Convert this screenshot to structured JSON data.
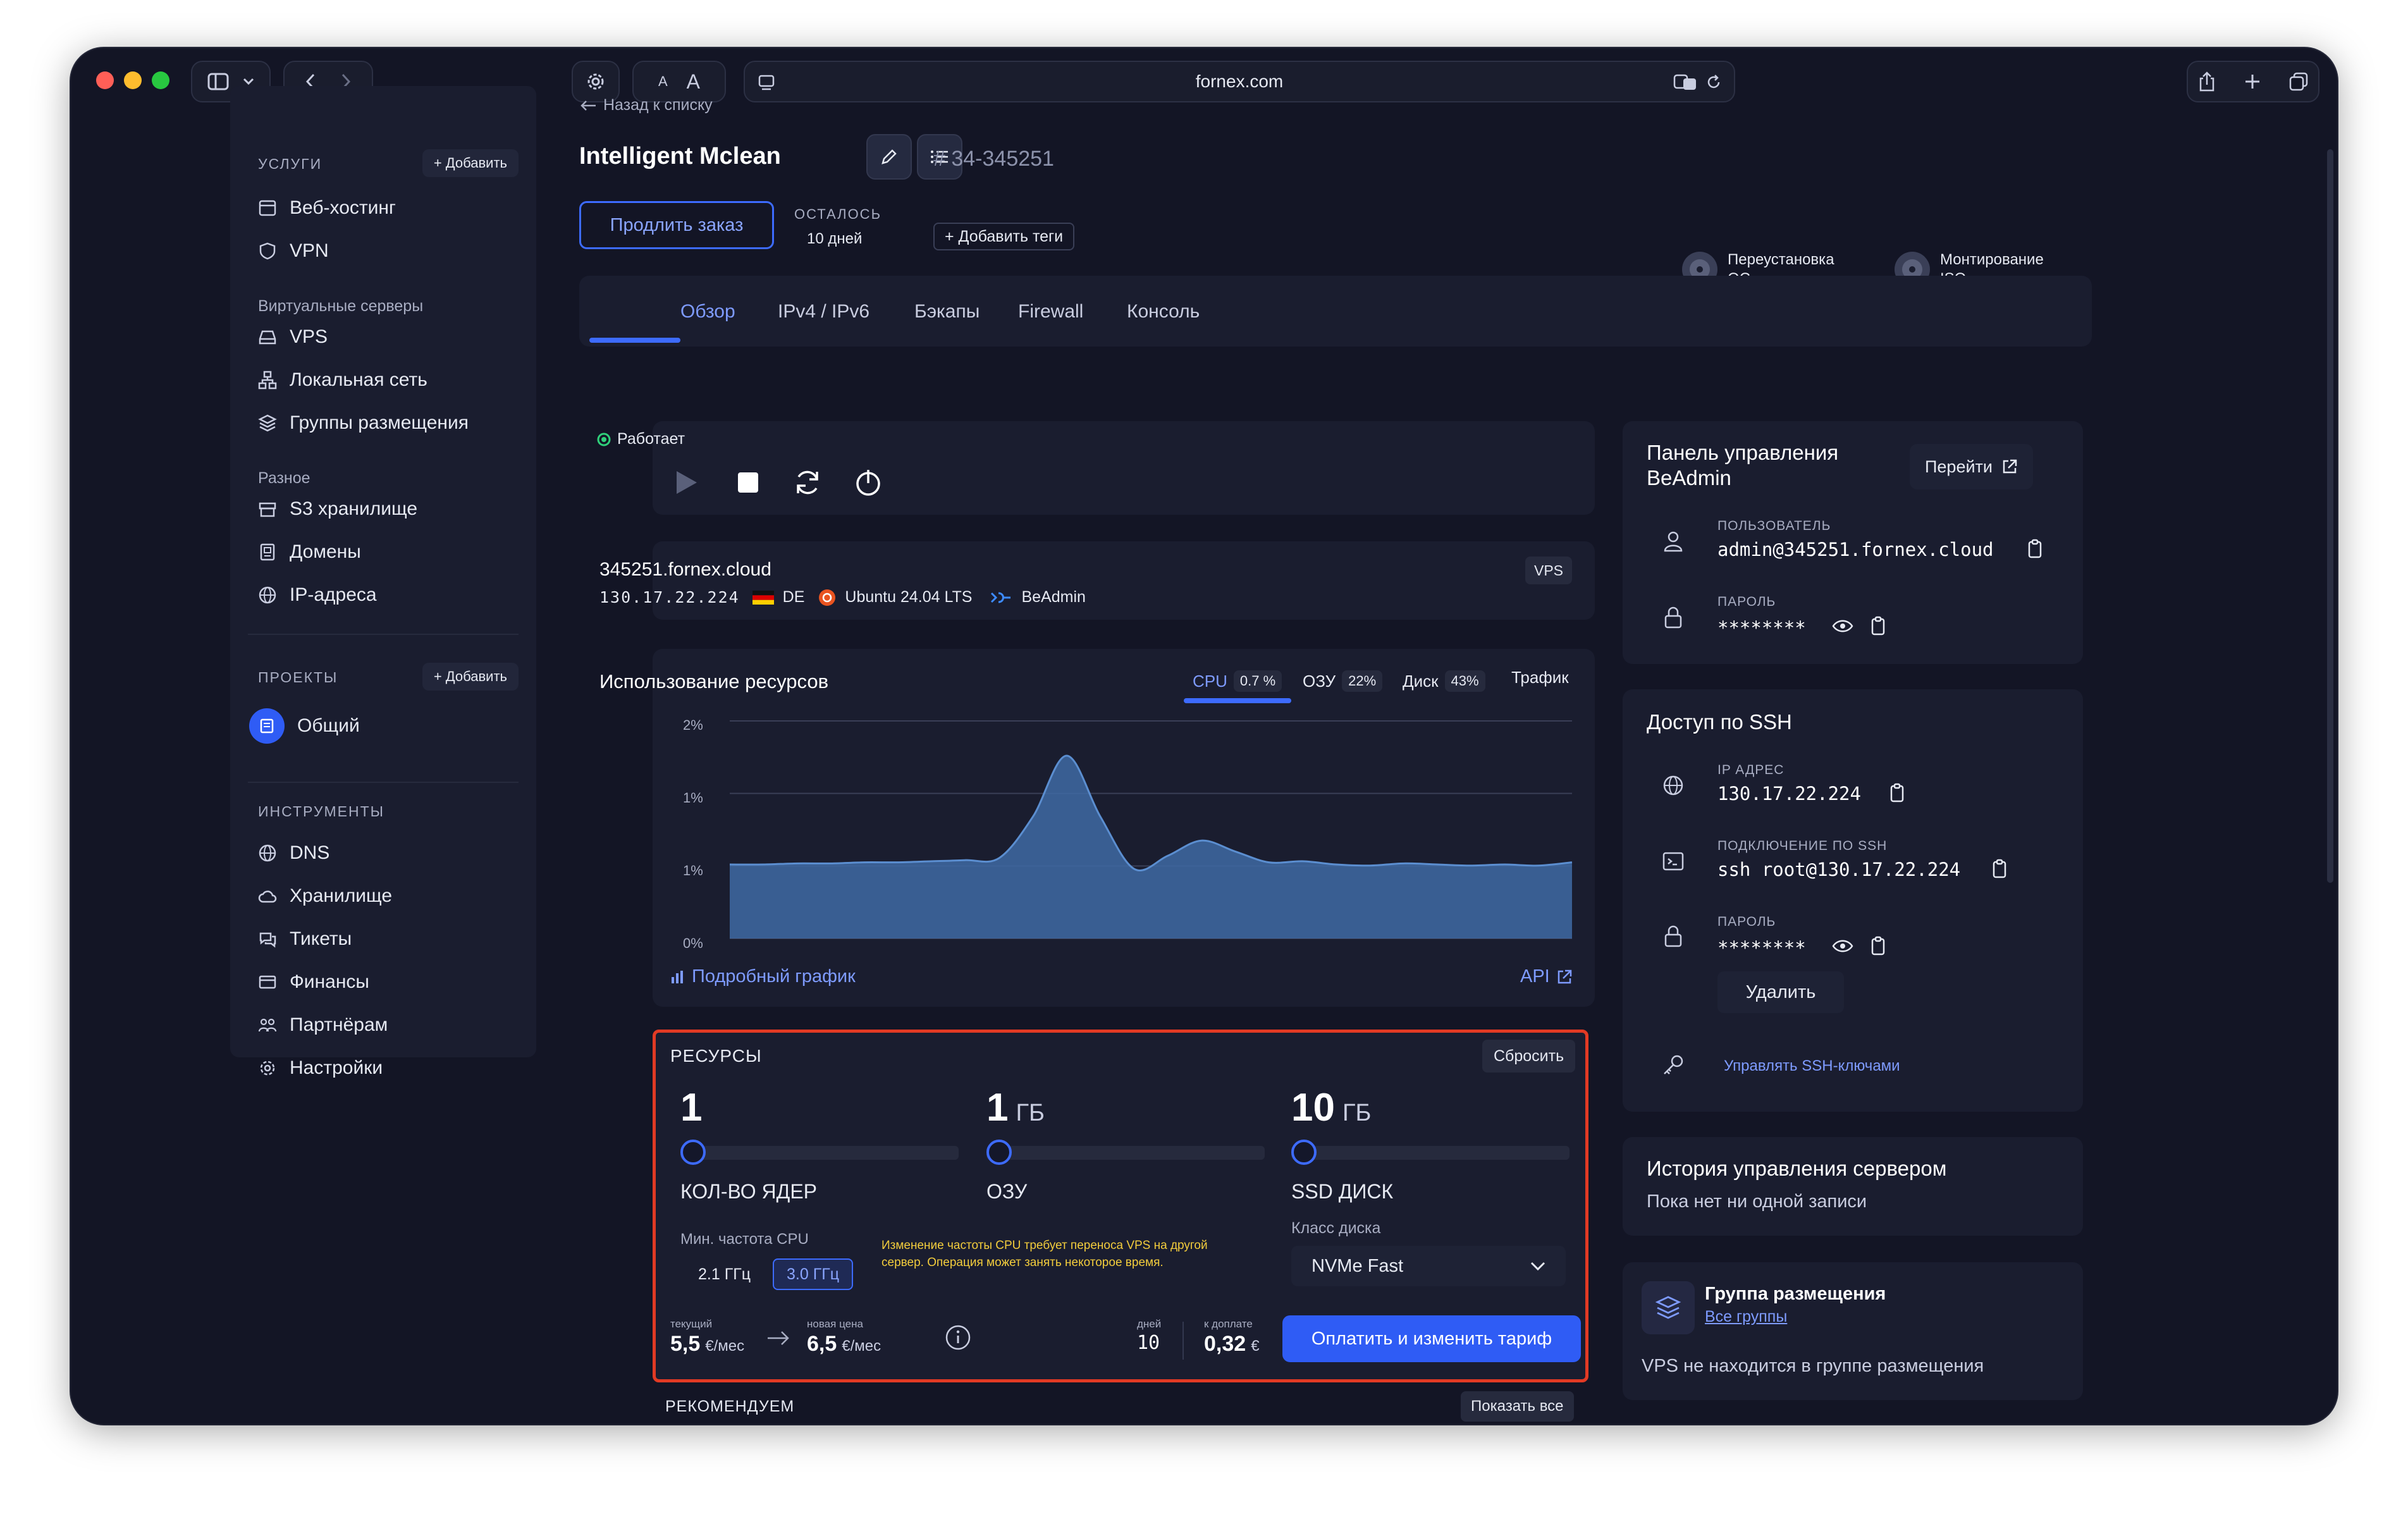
{
  "browser": {
    "url": "fornex.com",
    "font_small": "A",
    "font_large": "A"
  },
  "sidebar": {
    "services_heading": "УСЛУГИ",
    "add_label": "+ Добавить",
    "services": [
      {
        "label": "Веб-хостинг",
        "icon": "server-icon"
      },
      {
        "label": "VPN",
        "icon": "shield-icon"
      }
    ],
    "virtual_heading": "Виртуальные серверы",
    "virtual": [
      {
        "label": "VPS",
        "icon": "drive-icon"
      },
      {
        "label": "Локальная сеть",
        "icon": "network-icon"
      },
      {
        "label": "Группы размещения",
        "icon": "layers-icon"
      }
    ],
    "misc_heading": "Разное",
    "misc": [
      {
        "label": "S3 хранилище",
        "icon": "box-icon"
      },
      {
        "label": "Домены",
        "icon": "domain-icon"
      },
      {
        "label": "IP-адреса",
        "icon": "globe-icon"
      }
    ],
    "projects_heading": "ПРОЕКТЫ",
    "project": "Общий",
    "tools_heading": "ИНСТРУМЕНТЫ",
    "tools": [
      {
        "label": "DNS",
        "icon": "globe-icon"
      },
      {
        "label": "Хранилище",
        "icon": "cloud-icon"
      },
      {
        "label": "Тикеты",
        "icon": "chat-icon"
      },
      {
        "label": "Финансы",
        "icon": "wallet-icon"
      },
      {
        "label": "Партнёрам",
        "icon": "users-icon"
      },
      {
        "label": "Настройки",
        "icon": "gear-icon"
      }
    ]
  },
  "header": {
    "back": "Назад к списку",
    "title": "Intelligent Mclean",
    "order_id": "# 34-345251",
    "renew": "Продлить заказ",
    "remaining_label": "ОСТАЛОСЬ",
    "remaining_value": "10 дней",
    "add_tags": "+ Добавить теги",
    "reinstall": "Переустановка\nОС",
    "mount": "Монтирование\nISO"
  },
  "tabs": [
    "Обзор",
    "IPv4 / IPv6",
    "Бэкапы",
    "Firewall",
    "Консоль"
  ],
  "server": {
    "status": "Работает",
    "hostname": "345251.fornex.cloud",
    "ip": "130.17.22.224",
    "country": "DE",
    "os": "Ubuntu 24.04 LTS",
    "panel": "BeAdmin",
    "badge": "VPS"
  },
  "usage": {
    "title": "Использование ресурсов",
    "metrics": [
      {
        "label": "CPU",
        "value": "0.7 %"
      },
      {
        "label": "ОЗУ",
        "value": "22%"
      },
      {
        "label": "Диск",
        "value": "43%"
      },
      {
        "label": "Трафик",
        "value": ""
      }
    ],
    "details_link": "Подробный график",
    "api_link": "API"
  },
  "chart_data": {
    "type": "area",
    "y_ticks": [
      "2%",
      "1%",
      "1%",
      "0%"
    ],
    "ylim": [
      0,
      2
    ],
    "values": [
      0.68,
      0.68,
      0.69,
      0.69,
      0.7,
      0.7,
      0.71,
      0.72,
      0.74,
      1.12,
      1.68,
      1.12,
      0.64,
      0.76,
      0.9,
      0.8,
      0.7,
      0.71,
      0.68,
      0.67,
      0.69,
      0.68,
      0.67,
      0.68,
      0.67,
      0.7
    ],
    "grid": true
  },
  "resources": {
    "title": "РЕСУРСЫ",
    "reset": "Сбросить",
    "cores_value": "1",
    "cores_label": "КОЛ-ВО ЯДЕР",
    "ram_value": "1",
    "ram_unit": "ГБ",
    "ram_label": "ОЗУ",
    "disk_value": "10",
    "disk_unit": "ГБ",
    "disk_label": "SSD ДИСК",
    "sliders": [
      0,
      0,
      0
    ],
    "freq_label": "Мин. частота CPU",
    "freq_options": [
      "2.1 ГГц",
      "3.0 ГГц"
    ],
    "warning": "Изменение частоты CPU требует переноса VPS на другой сервер. Операция может занять некоторое время.",
    "disk_class_label": "Класс диска",
    "disk_class": "NVMe Fast",
    "current_label": "текущий",
    "current_price": "5,5",
    "new_label": "новая цена",
    "new_price": "6,5",
    "price_unit": "€/мес",
    "days_label": "дней",
    "days": "10",
    "due_label": "к доплате",
    "due": "0,32",
    "due_unit": "€",
    "pay": "Оплатить и изменить тариф"
  },
  "recommend": {
    "title": "РЕКОМЕНДУЕМ",
    "show_all": "Показать все"
  },
  "panel": {
    "title": "Панель управления\nBeAdmin",
    "go": "Перейти",
    "user_label": "ПОЛЬЗОВАТЕЛЬ",
    "user": "admin@345251.fornex.cloud",
    "password_label": "ПАРОЛЬ",
    "password": "********"
  },
  "ssh": {
    "title": "Доступ по SSH",
    "ip_label": "IP АДРЕС",
    "ip": "130.17.22.224",
    "conn_label": "ПОДКЛЮЧЕНИЕ ПО SSH",
    "conn": "ssh root@130.17.22.224",
    "password_label": "ПАРОЛЬ",
    "password": "********",
    "delete": "Удалить",
    "manage_keys": "Управлять SSH-ключами"
  },
  "history": {
    "title": "История управления сервером",
    "empty": "Пока нет ни одной записи"
  },
  "placement": {
    "title": "Группа размещения",
    "all_groups": "Все группы",
    "note": "VPS не находится в группе размещения"
  },
  "colors": {
    "accent": "#3d6bff",
    "status_ok": "#2fd07a",
    "highlight_border": "#e23a24",
    "warning_text": "#f2cc3c"
  }
}
